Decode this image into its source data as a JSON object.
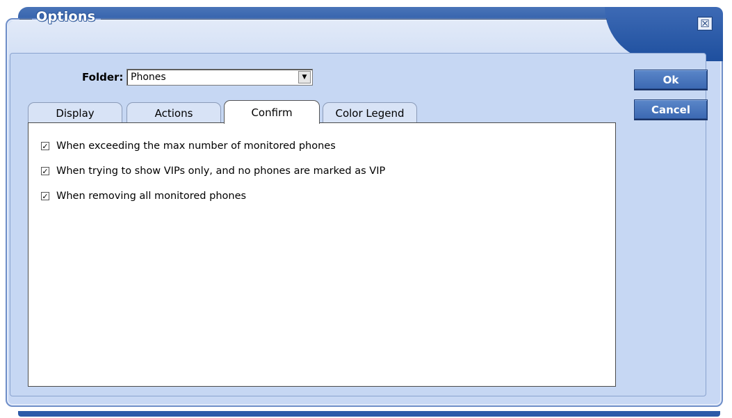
{
  "window": {
    "title": "Options",
    "close_glyph": "☒"
  },
  "folder": {
    "label": "Folder:",
    "value": "Phones",
    "dropdown_glyph": "▼"
  },
  "tabs": [
    {
      "label": "Display",
      "active": false
    },
    {
      "label": "Actions",
      "active": false
    },
    {
      "label": "Confirm",
      "active": true
    },
    {
      "label": "Color Legend",
      "active": false
    }
  ],
  "confirm_options": [
    {
      "label": "When exceeding the max number of monitored phones",
      "checked": true
    },
    {
      "label": "When trying to show VIPs only, and no phones are marked as VIP",
      "checked": true
    },
    {
      "label": "When removing all monitored phones",
      "checked": true
    }
  ],
  "buttons": {
    "ok": "Ok",
    "cancel": "Cancel"
  },
  "colors": {
    "accent": "#3b68b2",
    "title_bar": "#2553a0",
    "panel": "#c6d7f3"
  },
  "icons": {
    "check": "✓"
  }
}
